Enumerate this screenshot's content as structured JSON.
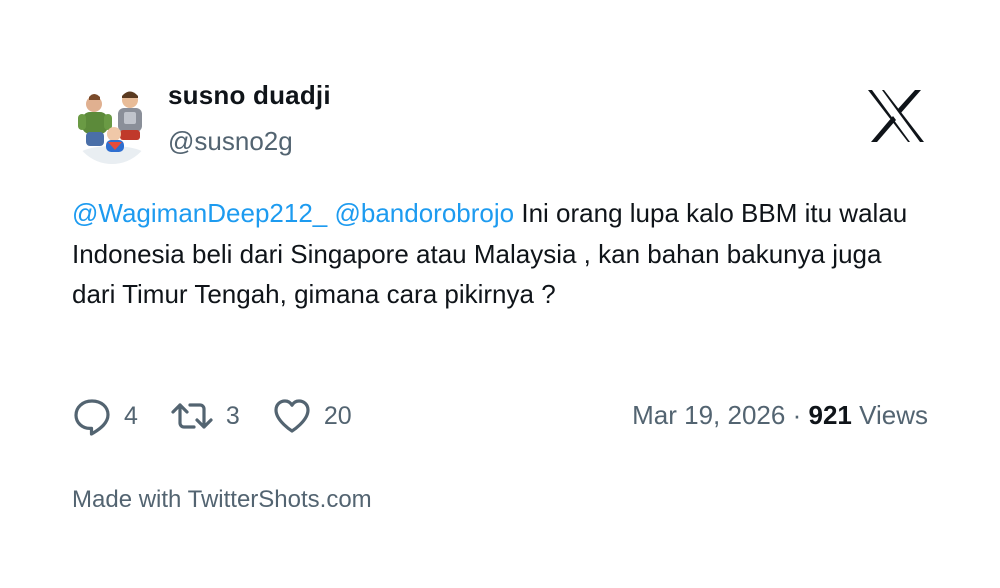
{
  "author": {
    "display_name": "susno duadji",
    "handle": "@susno2g"
  },
  "tweet": {
    "mention_1": "@WagimanDeep212_",
    "mention_2": "@bandorobrojo",
    "body": " Ini orang lupa kalo BBM itu walau Indonesia beli dari Singapore atau Malaysia , kan bahan bakunya juga dari Timur Tengah, gimana cara pikirnya ?"
  },
  "stats": {
    "replies": "4",
    "retweets": "3",
    "likes": "20"
  },
  "meta": {
    "date": "Mar 19, 2026",
    "separator": "·",
    "views_count": "921",
    "views_label": "Views"
  },
  "footer": {
    "text": "Made with TwitterShots.com"
  },
  "icons": {
    "logo": "x-logo-icon",
    "reply": "reply-icon",
    "retweet": "retweet-icon",
    "like": "heart-icon"
  },
  "colors": {
    "text": "#0f1419",
    "secondary": "#536471",
    "mention": "#1d9bf0",
    "background": "#ffffff"
  }
}
